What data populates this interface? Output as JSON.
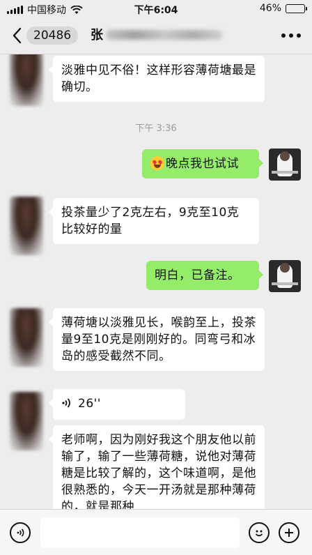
{
  "status_bar": {
    "carrier": "中国移动",
    "time": "下午6:04",
    "battery": "46%",
    "battery_level": 0.46
  },
  "header": {
    "unread_badge": "20486",
    "title": "张"
  },
  "messages": [
    {
      "side": "left",
      "text": "淡雅中见不俗！这样形容薄荷塘最是确切。"
    },
    {
      "type": "timestamp",
      "text": "下午 3:36"
    },
    {
      "side": "right",
      "emoji": "star-struck-face-icon",
      "text": "晚点我也试试"
    },
    {
      "side": "left",
      "text": "投茶量少了2克左右，9克至10克比较好的量"
    },
    {
      "side": "right",
      "text": "明白，已备注。"
    },
    {
      "side": "left",
      "text": "薄荷塘以淡雅见长，喉韵至上，投茶量9至10克是刚刚好的。同弯弓和冰岛的感受截然不同。"
    },
    {
      "side": "left",
      "type": "voice",
      "duration": "26''"
    },
    {
      "side": "left",
      "text": "老师啊，因为刚好我这个朋友他以前输了，输了一些薄荷糖，说他对薄荷糖是比较了解的，这个味道啊，是他很熟悉的，今天一开汤就是那种薄荷的，就是那种"
    }
  ],
  "input_bar": {
    "placeholder": "",
    "icons": [
      "voice-input-icon",
      "emoji-icon",
      "add-icon"
    ]
  },
  "colors": {
    "background": "#ededed",
    "bubble_right": "#95ec69",
    "bubble_left": "#ffffff"
  }
}
